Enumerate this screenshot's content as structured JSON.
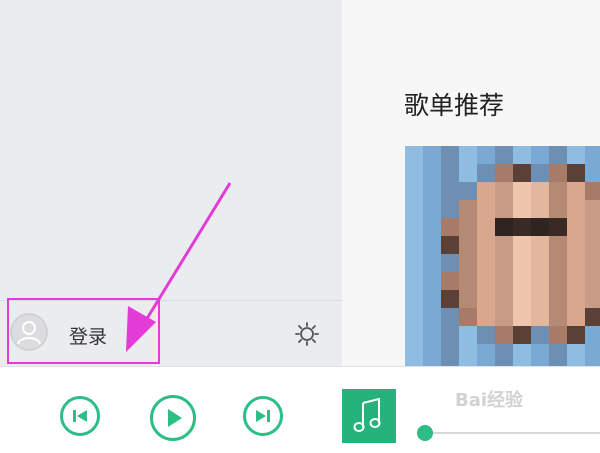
{
  "sidebar": {
    "login_label": "登录"
  },
  "main": {
    "section_title": "歌单推荐"
  },
  "player": {
    "progress": 0.0
  },
  "colors": {
    "accent": "#2cbe84",
    "annotation": "#e33bd8",
    "sidebar_bg": "#ebecef"
  },
  "icons": {
    "avatar": "user-avatar-icon",
    "settings": "gear-icon",
    "prev": "previous-track-icon",
    "play": "play-icon",
    "next": "next-track-icon",
    "music": "music-note-icon"
  },
  "watermark": {
    "brand": "Bai",
    "suffix": "经验"
  }
}
